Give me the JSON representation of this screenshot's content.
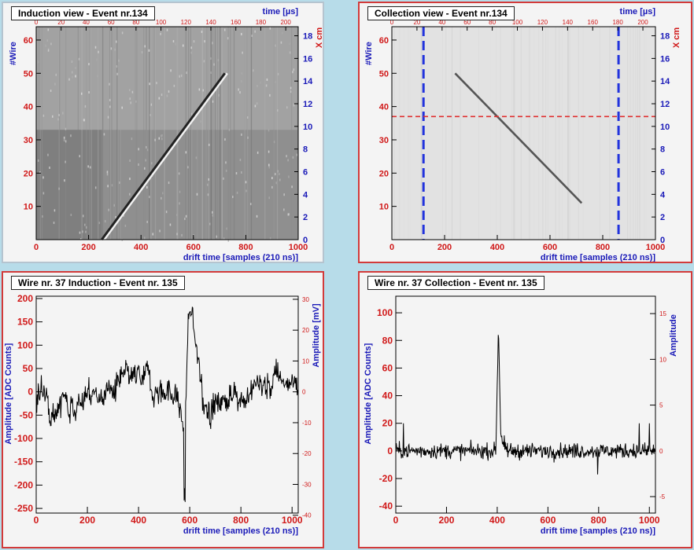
{
  "panels": {
    "induction_view": {
      "title": "Induction view - Event nr.134"
    },
    "collection_view": {
      "title": "Collection view - Event nr.134"
    },
    "wire_induction": {
      "title": "Wire nr. 37 Induction - Event nr. 135"
    },
    "wire_collection": {
      "title": "Wire nr. 37 Collection - Event nr. 135"
    }
  },
  "chart_data": [
    {
      "type": "heatmap",
      "title": "Induction view - Event nr.134",
      "xlabel": "drift time [samples (210 ns)]",
      "ylabel": "#Wire",
      "top_axis_label": "time [µs]",
      "right_axis_label": "X cm",
      "xlim": [
        0,
        1000
      ],
      "ylim": [
        0,
        64
      ],
      "top_lim": [
        0,
        210
      ],
      "right_lim": [
        0,
        18.8
      ],
      "x_ticks": [
        0,
        200,
        400,
        600,
        800,
        1000
      ],
      "y_ticks": [
        10,
        20,
        30,
        40,
        50,
        60
      ],
      "top_ticks": [
        0,
        20,
        40,
        60,
        80,
        100,
        120,
        140,
        160,
        180,
        200
      ],
      "right_ticks": [
        0,
        2,
        4,
        6,
        8,
        10,
        12,
        14,
        16,
        18
      ],
      "track": [
        {
          "x": 250,
          "y": 0
        },
        {
          "x": 720,
          "y": 50
        }
      ]
    },
    {
      "type": "heatmap",
      "title": "Collection view - Event nr.134",
      "xlabel": "drift time [samples (210 ns)]",
      "ylabel": "#Wire",
      "top_axis_label": "time [µs]",
      "right_axis_label": "X cm",
      "xlim": [
        0,
        1000
      ],
      "ylim": [
        0,
        64
      ],
      "top_lim": [
        0,
        210
      ],
      "right_lim": [
        0,
        18.8
      ],
      "x_ticks": [
        0,
        200,
        400,
        600,
        800,
        1000
      ],
      "y_ticks": [
        10,
        20,
        30,
        40,
        50,
        60
      ],
      "top_ticks": [
        0,
        20,
        40,
        60,
        80,
        100,
        120,
        140,
        160,
        180,
        200
      ],
      "right_ticks": [
        0,
        2,
        4,
        6,
        8,
        10,
        12,
        14,
        16,
        18
      ],
      "track": [
        {
          "x": 240,
          "y": 50
        },
        {
          "x": 720,
          "y": 11
        }
      ],
      "markers": {
        "vertical_x": [
          120,
          860
        ],
        "horizontal_y": 37
      }
    },
    {
      "type": "line",
      "title": "Wire nr. 37 Induction - Event nr. 135",
      "xlabel": "drift time [samples (210 ns)]",
      "ylabel": "Amplitude [ADC Counts]",
      "right_axis_label": "Amplitude [mV]",
      "xlim": [
        0,
        1024
      ],
      "ylim": [
        -260,
        205
      ],
      "right_lim": [
        -39.3,
        31.0
      ],
      "x_ticks": [
        0,
        200,
        400,
        600,
        800,
        1000
      ],
      "y_ticks": [
        -250,
        -200,
        -150,
        -100,
        -50,
        0,
        50,
        100,
        150,
        200
      ],
      "right_ticks": [
        -40,
        -30,
        -20,
        -10,
        0,
        10,
        20,
        30
      ],
      "features": [
        {
          "x": 580,
          "y": -245,
          "kind": "min"
        },
        {
          "x": 600,
          "y": 185,
          "kind": "max"
        }
      ],
      "baseline": 0
    },
    {
      "type": "line",
      "title": "Wire nr. 37 Collection - Event nr. 135",
      "xlabel": "drift time [samples (210 ns)]",
      "ylabel": "Amplitude [ADC Counts]",
      "right_axis_label": "Amplitude",
      "xlim": [
        0,
        1024
      ],
      "ylim": [
        -45,
        112
      ],
      "right_lim": [
        -6.8,
        16.9
      ],
      "x_ticks": [
        0,
        200,
        400,
        600,
        800,
        1000
      ],
      "y_ticks": [
        -40,
        -20,
        0,
        20,
        40,
        60,
        80,
        100
      ],
      "right_ticks": [
        -5,
        0,
        5,
        10,
        15
      ],
      "features": [
        {
          "x": 405,
          "y": 90,
          "kind": "max"
        }
      ],
      "baseline": 0
    }
  ]
}
